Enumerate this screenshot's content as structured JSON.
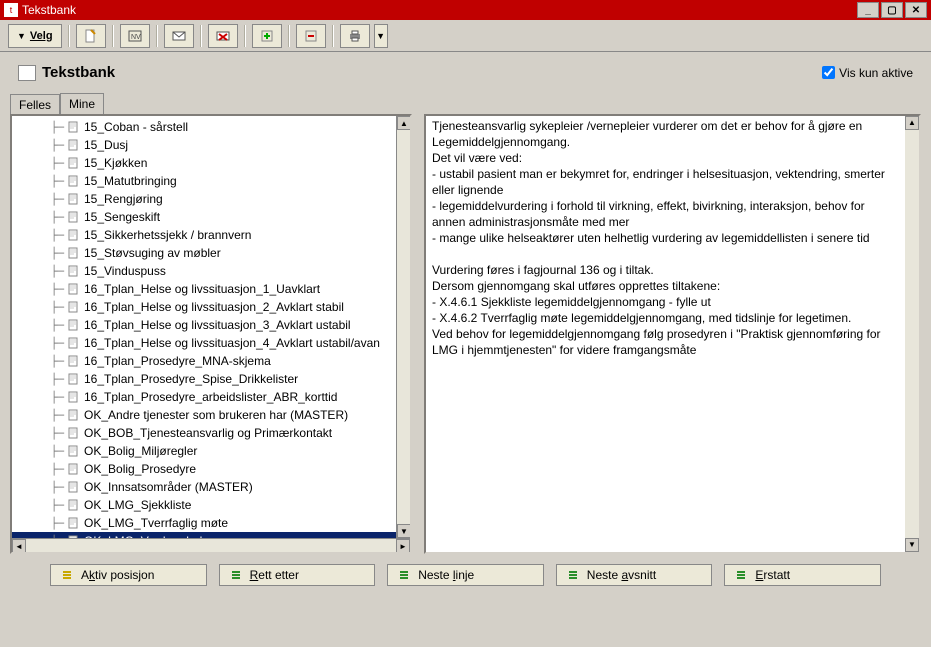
{
  "titlebar": {
    "title": "Tekstbank"
  },
  "toolbar": {
    "velg_label": "Velg",
    "icons": [
      "new-doc",
      "nv",
      "mail",
      "mail-x",
      "green-plus",
      "red-minus",
      "printer"
    ]
  },
  "header": {
    "title": "Tekstbank",
    "vis_kun_aktive_label": "Vis kun aktive",
    "vis_kun_aktive_checked": true
  },
  "tabs": [
    {
      "label": "Felles",
      "active": true
    },
    {
      "label": "Mine",
      "active": false
    }
  ],
  "tree": {
    "items": [
      {
        "label": "15_Coban - sårstell"
      },
      {
        "label": "15_Dusj"
      },
      {
        "label": "15_Kjøkken"
      },
      {
        "label": "15_Matutbringing"
      },
      {
        "label": "15_Rengjøring"
      },
      {
        "label": "15_Sengeskift"
      },
      {
        "label": "15_Sikkerhetssjekk / brannvern"
      },
      {
        "label": "15_Støvsuging av møbler"
      },
      {
        "label": "15_Vinduspuss"
      },
      {
        "label": "16_Tplan_Helse og livssituasjon_1_Uavklart"
      },
      {
        "label": "16_Tplan_Helse og livssituasjon_2_Avklart stabil"
      },
      {
        "label": "16_Tplan_Helse og livssituasjon_3_Avklart ustabil"
      },
      {
        "label": "16_Tplan_Helse og livssituasjon_4_Avklart ustabil/avan"
      },
      {
        "label": "16_Tplan_Prosedyre_MNA-skjema"
      },
      {
        "label": "16_Tplan_Prosedyre_Spise_Drikkelister"
      },
      {
        "label": "16_Tplan_Prosedyre_arbeidslister_ABR_korttid"
      },
      {
        "label": "OK_Andre tjenester som brukeren har (MASTER)"
      },
      {
        "label": "OK_BOB_Tjenesteansvarlig og Primærkontakt"
      },
      {
        "label": "OK_Bolig_Miljøregler"
      },
      {
        "label": "OK_Bolig_Prosedyre"
      },
      {
        "label": "OK_Innsatsområder (MASTER)"
      },
      {
        "label": "OK_LMG_Sjekkliste"
      },
      {
        "label": "OK_LMG_Tverrfaglig møte"
      },
      {
        "label": "OK_LMG_Vurdere behov",
        "selected": true
      }
    ]
  },
  "detail": {
    "lines": [
      "Tjenesteansvarlig sykepleier /vernepleier vurderer om det er behov for å gjøre en Legemiddelgjennomgang.",
      "Det vil være ved:",
      "- ustabil pasient man er bekymret for, endringer i helsesituasjon, vektendring, smerter eller lignende",
      "- legemiddelvurdering i forhold til virkning, effekt, bivirkning, interaksjon, behov for annen administrasjonsmåte med mer",
      "- mange ulike helseaktører uten helhetlig vurdering av legemiddellisten i senere tid",
      "",
      "Vurdering føres i fagjournal 136 og i tiltak.",
      "Dersom gjennomgang skal utføres opprettes tiltakene:",
      "- X.4.6.1 Sjekkliste legemiddelgjennomgang - fylle ut",
      "- X.4.6.2 Tverrfaglig møte legemiddelgjennomgang, med tidslinje for legetimen.",
      "Ved behov for legemiddelgjennomgang følg prosedyren i \"Praktisk gjennomføring for LMG i hjemmtjenesten\" for videre framgangsmåte"
    ]
  },
  "footer": {
    "buttons": [
      {
        "label_pre": "A",
        "label_under": "k",
        "label_post": "tiv posisjon",
        "icon_hint": "insert-here",
        "color": "#c8a800"
      },
      {
        "label_pre": "",
        "label_under": "R",
        "label_post": "ett etter",
        "icon_hint": "green-bars",
        "color": "#2a8f2a"
      },
      {
        "label_pre": "Neste ",
        "label_under": "l",
        "label_post": "inje",
        "icon_hint": "green-bars",
        "color": "#2a8f2a"
      },
      {
        "label_pre": "Neste ",
        "label_under": "a",
        "label_post": "vsnitt",
        "icon_hint": "green-bars",
        "color": "#2a8f2a"
      },
      {
        "label_pre": "",
        "label_under": "E",
        "label_post": "rstatt",
        "icon_hint": "green-bars",
        "color": "#2a8f2a"
      }
    ]
  }
}
